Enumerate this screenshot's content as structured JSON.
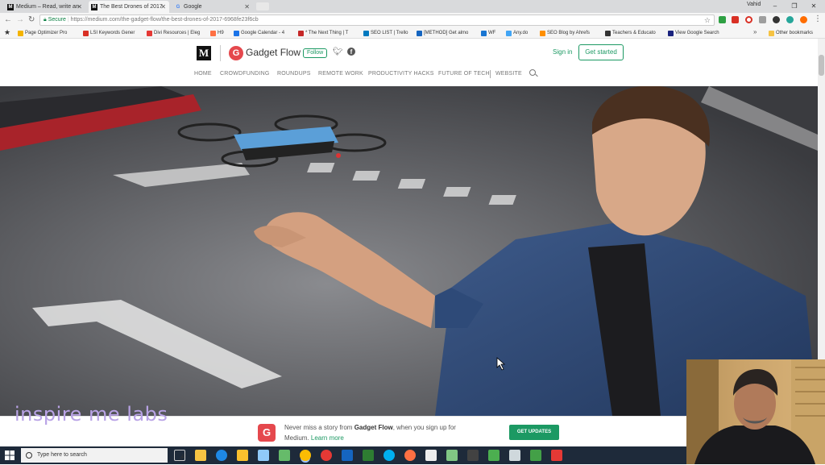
{
  "browser": {
    "tabs": [
      {
        "title": "Medium – Read, write an",
        "favicon": "M"
      },
      {
        "title": "The Best Drones of 2017",
        "favicon": "M"
      },
      {
        "title": "Google",
        "favicon": "G"
      }
    ],
    "profile_name": "Vahid",
    "address": {
      "secure_label": "Secure",
      "url_host": "https://medium.com",
      "url_path": "/the-gadget-flow/the-best-drones-of-2017-6968fe23f6cb"
    },
    "bookmarks": [
      {
        "label": "Page Optimizer Pro",
        "color": "#f4b400"
      },
      {
        "label": "LSI Keywords Gener",
        "color": "#d93025"
      },
      {
        "label": "Divi Resources | Eleg",
        "color": "#e53935"
      },
      {
        "label": "H9",
        "color": "#ff7043"
      },
      {
        "label": "Google Calendar - 4",
        "color": "#1a73e8"
      },
      {
        "label": "* The Next Thing | T",
        "color": "#c62828"
      },
      {
        "label": "SEO LIST | Trello",
        "color": "#0079bf"
      },
      {
        "label": "[METHOD] Get almo",
        "color": "#1565c0"
      },
      {
        "label": "WF",
        "color": "#1976d2"
      },
      {
        "label": "Any.do",
        "color": "#42a5f5"
      },
      {
        "label": "SEO Blog by Ahrefs",
        "color": "#ff8f00"
      },
      {
        "label": "Teachers & Educato",
        "color": "#333333"
      },
      {
        "label": "View Google Search",
        "color": "#1a237e"
      }
    ],
    "other_bookmarks": "Other bookmarks"
  },
  "page": {
    "medium_logo": "M",
    "publication": {
      "logo_letter": "G",
      "name": "Gadget Flow",
      "follow_label": "Follow"
    },
    "signin_label": "Sign in",
    "get_started_label": "Get started",
    "nav": [
      "HOME",
      "CROWDFUNDING",
      "ROUNDUPS",
      "REMOTE WORK",
      "PRODUCTIVITY HACKS",
      "FUTURE OF TECH",
      "WEBSITE"
    ]
  },
  "banner": {
    "logo_letter": "G",
    "text_prefix": "Never miss a story from ",
    "text_pub": "Gadget Flow",
    "text_mid": ", when you sign up for",
    "text_line2": "Medium. ",
    "learn_more": "Learn more",
    "cta": "GET UPDATES"
  },
  "watermark": "inspire me labs",
  "taskbar": {
    "search_placeholder": "Type here to search"
  }
}
